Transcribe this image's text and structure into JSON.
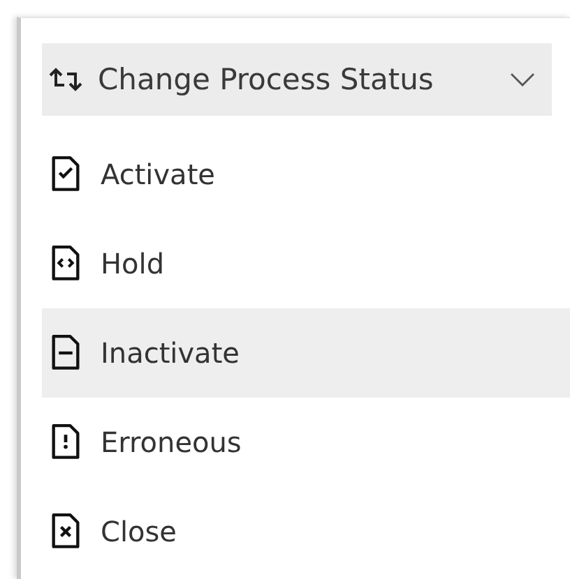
{
  "menu_button": {
    "label": "Change Process Status",
    "expanded": true
  },
  "items": [
    {
      "label": "Activate",
      "kind": "check",
      "highlighted": false
    },
    {
      "label": "Hold",
      "kind": "code",
      "highlighted": false
    },
    {
      "label": "Inactivate",
      "kind": "minus",
      "highlighted": true
    },
    {
      "label": "Erroneous",
      "kind": "alert",
      "highlighted": false
    },
    {
      "label": "Close",
      "kind": "cross",
      "highlighted": false
    }
  ]
}
